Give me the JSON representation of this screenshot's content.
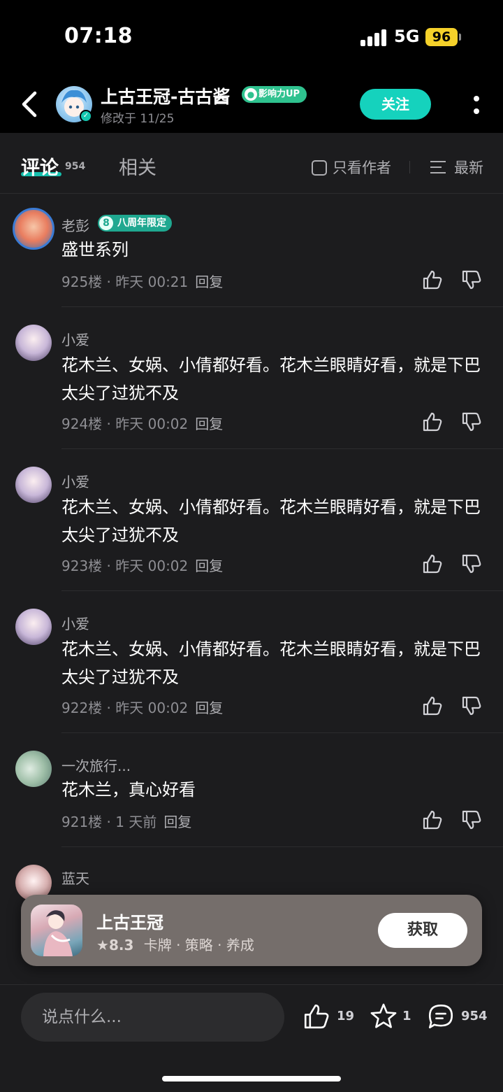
{
  "status_bar": {
    "time": "07:18",
    "network": "5G",
    "battery": "96"
  },
  "header": {
    "author_name": "上古王冠-古古酱",
    "badge": "影响力UP",
    "modified": "修改于 11/25",
    "follow_label": "关注"
  },
  "tabs": {
    "comments_label": "评论",
    "comments_count": "954",
    "related_label": "相关",
    "only_author_label": "只看作者",
    "sort_label": "最新"
  },
  "comments": [
    {
      "name": "老彭",
      "badge": "八周年限定",
      "badge_num": "8",
      "text": "盛世系列",
      "floor": "925楼",
      "time": "昨天 00:21",
      "reply": "回复"
    },
    {
      "name": "小爱",
      "text": "花木兰、女娲、小倩都好看。花木兰眼睛好看，就是下巴太尖了过犹不及",
      "floor": "924楼",
      "time": "昨天 00:02",
      "reply": "回复"
    },
    {
      "name": "小爱",
      "text": "花木兰、女娲、小倩都好看。花木兰眼睛好看，就是下巴太尖了过犹不及",
      "floor": "923楼",
      "time": "昨天 00:02",
      "reply": "回复"
    },
    {
      "name": "小爱",
      "text": "花木兰、女娲、小倩都好看。花木兰眼睛好看，就是下巴太尖了过犹不及",
      "floor": "922楼",
      "time": "昨天 00:02",
      "reply": "回复"
    },
    {
      "name": "一次旅行...",
      "text": "花木兰，真心好看",
      "floor": "921楼",
      "time": "1 天前",
      "reply": "回复"
    },
    {
      "name": "蓝天"
    }
  ],
  "game_card": {
    "name": "上古王冠",
    "score": "8.3",
    "tags": "卡牌 · 策略 · 养成",
    "get_label": "获取"
  },
  "bottom_bar": {
    "input_placeholder": "说点什么...",
    "like_count": "19",
    "fav_count": "1",
    "comment_count": "954"
  },
  "colors": {
    "accent": "#15d2bd",
    "background": "#1c1c1e",
    "header_bg": "#000000"
  }
}
